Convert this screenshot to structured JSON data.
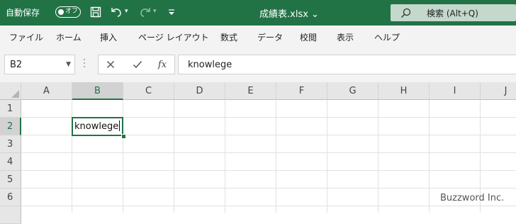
{
  "titlebar": {
    "autosave_label": "自動保存",
    "autosave_state": "オフ",
    "filename": "成績表.xlsx",
    "search_placeholder": "検索 (Alt+Q)",
    "accent_color": "#217346"
  },
  "ribbon": {
    "tabs": [
      "ファイル",
      "ホーム",
      "挿入",
      "ページ レイアウト",
      "数式",
      "データ",
      "校閲",
      "表示",
      "ヘルプ"
    ]
  },
  "formula_bar": {
    "name_box": "B2",
    "formula": "knowlege",
    "fx_symbol": "fx"
  },
  "sheet": {
    "columns": [
      "A",
      "B",
      "C",
      "D",
      "E",
      "F",
      "G",
      "H",
      "I",
      "J"
    ],
    "rows": [
      "1",
      "2",
      "3",
      "4",
      "5",
      "6"
    ],
    "selected_column": "B",
    "selected_row": "2",
    "active_cell_value": "knowlege"
  },
  "watermark": "Buzzword Inc."
}
